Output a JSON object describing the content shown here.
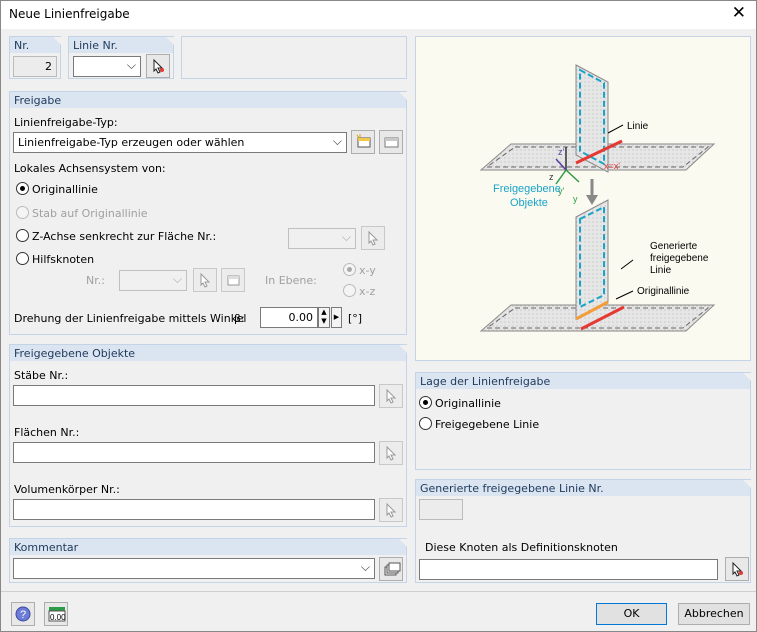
{
  "window": {
    "title": "Neue Linienfreigabe",
    "close": "✕"
  },
  "top": {
    "nr_label": "Nr.",
    "nr_value": "2",
    "line_nr_label": "Linie Nr.",
    "line_nr_value": ""
  },
  "freigabe": {
    "header": "Freigabe",
    "type_label": "Linienfreigabe-Typ:",
    "type_value": "Linienfreigabe-Typ erzeugen oder wählen",
    "axis_label": "Lokales Achsensystem von:",
    "radio_original": "Originallinie",
    "radio_stab": "Stab auf Originallinie",
    "radio_zaxis": "Z-Achse senkrecht zur Fläche Nr.:",
    "radio_hilfsknoten": "Hilfsknoten",
    "nr_label": "Nr.:",
    "in_ebene_label": "In Ebene:",
    "plane_xy": "x-y",
    "plane_xz": "x-z",
    "rotation_label": "Drehung der Linienfreigabe mittels Winkel",
    "beta_label": "β:",
    "rotation_value": "0.00",
    "rotation_unit": "[°]"
  },
  "objects": {
    "header": "Freigegebene Objekte",
    "members_label": "Stäbe Nr.:",
    "members_value": "",
    "surfaces_label": "Flächen Nr.:",
    "surfaces_value": "",
    "solids_label": "Volumenkörper Nr.:",
    "solids_value": ""
  },
  "comment": {
    "header": "Kommentar",
    "value": ""
  },
  "diagram": {
    "label_linie": "Linie",
    "label_x": "x=x'",
    "label_z1": "z'",
    "label_z": "z",
    "label_y1": "y'",
    "label_y": "y",
    "label_freigegebene": "Freigegebene",
    "label_objekte": "Objekte",
    "label_generierte": "Generierte",
    "label_freigegebene2": "freigegebene",
    "label_linie2": "Linie",
    "label_originallinie": "Originallinie"
  },
  "lage": {
    "header": "Lage der Linienfreigabe",
    "opt_original": "Originallinie",
    "opt_freigegebene": "Freigegebene Linie"
  },
  "generated": {
    "header": "Generierte freigegebene Linie Nr.",
    "value": "",
    "nodes_label": "Diese Knoten als Definitionsknoten",
    "nodes_value": ""
  },
  "footer": {
    "ok": "OK",
    "cancel": "Abbrechen",
    "units_icon_text": "0.00"
  },
  "colors": {
    "panel_header": "#dbe5f1",
    "panel_header_text": "#1e395b",
    "accent": "#0078d7",
    "release_line": "#e53935",
    "original_line": "#f39c3a",
    "released_label": "#1aa3c8"
  }
}
